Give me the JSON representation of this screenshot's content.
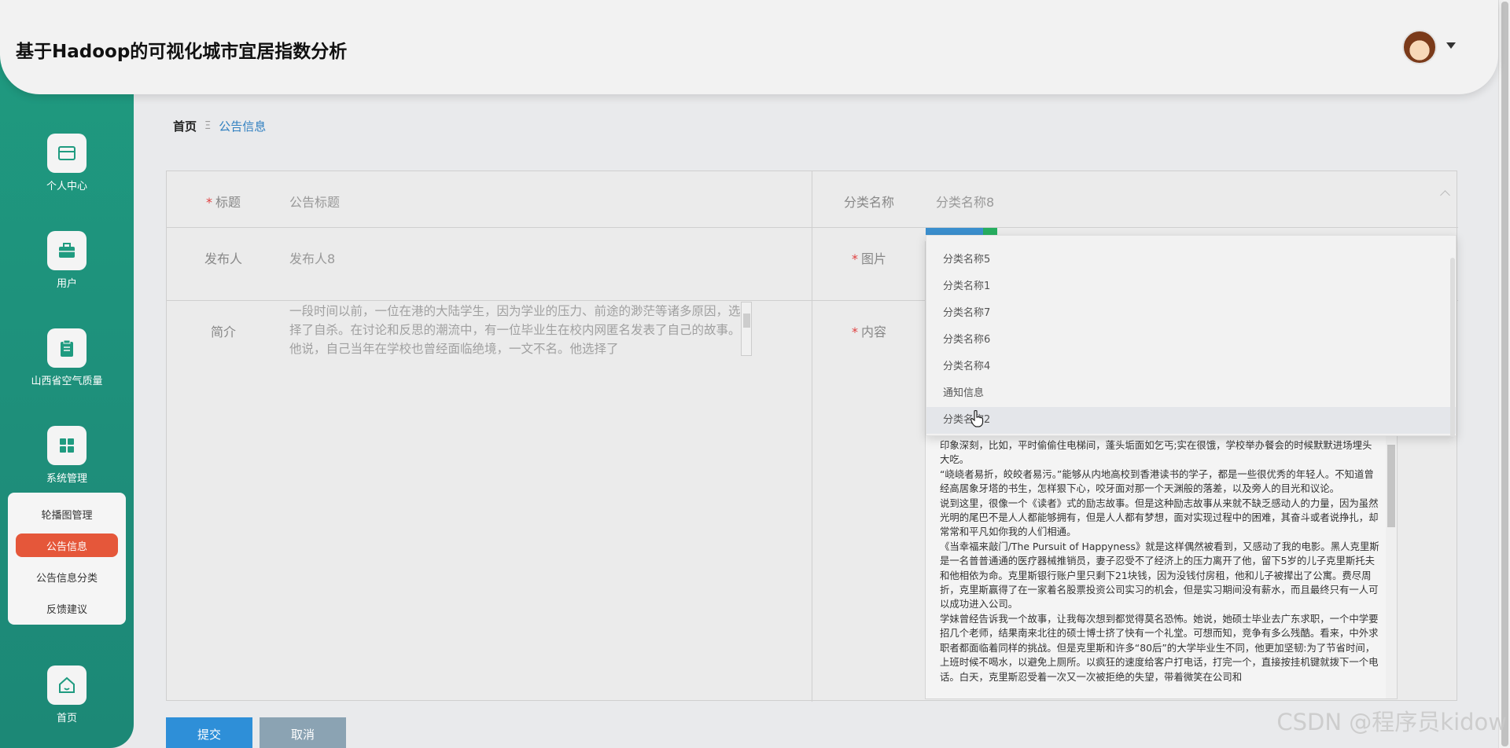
{
  "header": {
    "title": "基于Hadoop的可视化城市宜居指数分析"
  },
  "sidebar": {
    "items": [
      {
        "label": "个人中心",
        "icon": "card-icon"
      },
      {
        "label": "用户",
        "icon": "briefcase-icon"
      },
      {
        "label": "山西省空气质量",
        "icon": "clipboard-icon"
      },
      {
        "label": "系统管理",
        "icon": "grid-icon"
      },
      {
        "label": "首页",
        "icon": "home-icon"
      }
    ],
    "submenu": [
      {
        "label": "轮播图管理",
        "active": false
      },
      {
        "label": "公告信息",
        "active": true
      },
      {
        "label": "公告信息分类",
        "active": false
      },
      {
        "label": "反馈建议",
        "active": false
      }
    ]
  },
  "breadcrumb": {
    "home": "首页",
    "current": "公告信息"
  },
  "form": {
    "title_label": "标题",
    "title_value": "公告标题",
    "category_label": "分类名称",
    "category_value": "分类名称8",
    "publisher_label": "发布人",
    "publisher_value": "发布人8",
    "image_label": "图片",
    "summary_label": "简介",
    "summary_value": "一段时间以前，一位在港的大陆学生，因为学业的压力、前途的渺茫等诸多原因，选择了自杀。在讨论和反思的潮流中，有一位毕业生在校内网匿名发表了自己的故事。他说，自己当年在学校也曾经面临绝境，一文不名。他选择了",
    "content_label": "内容",
    "content_paragraphs": [
      "印象深刻，比如，平时偷偷住电梯间，蓬头垢面如乞丐;实在很饿，学校举办餐会的时候默默进场埋头大吃。",
      "“峣峣者易折，皎皎者易污。”能够从内地高校到香港读书的学子，都是一些很优秀的年轻人。不知道曾经高居象牙塔的书生，怎样狠下心，咬牙面对那一个天渊般的落差，以及旁人的目光和议论。",
      "说到这里，很像一个《读者》式的励志故事。但是这种励志故事从来就不缺乏感动人的力量，因为虽然光明的尾巴不是人人都能够拥有，但是人人都有梦想，面对实现过程中的困难，其奋斗或者说挣扎，却常常和平凡如你我的人们相通。",
      "《当幸福来敲门/The Pursuit of Happyness》就是这样偶然被看到，又感动了我的电影。黑人克里斯是一名普普通通的医疗器械推销员，妻子忍受不了经济上的压力离开了他，留下5岁的儿子克里斯托夫和他相依为命。克里斯银行账户里只剩下21块钱，因为没钱付房租，他和儿子被撵出了公寓。费尽周折，克里斯赢得了在一家着名股票投资公司实习的机会，但是实习期间没有薪水，而且最终只有一人可以成功进入公司。",
      "学妹曾经告诉我一个故事，让我每次想到都觉得莫名恐怖。她说，她硕士毕业去广东求职，一个中学要招几个老师，结果南来北往的硕士博士挤了快有一个礼堂。可想而知，竞争有多么残酷。看来，中外求职者都面临着同样的挑战。但是克里斯和许多“80后”的大学毕业生不同，他更加坚韧:为了节省时间，上班时候不喝水，以避免上厕所。以疯狂的速度给客户打电话，打完一个，直接按挂机键就拨下一个电话。白天，克里斯忍受着一次又一次被拒绝的失望，带着微笑在公司和"
    ]
  },
  "dropdown": {
    "options": [
      "分类名称5",
      "分类名称1",
      "分类名称7",
      "分类名称6",
      "分类名称4",
      "通知信息",
      "分类名称2"
    ],
    "hovered_index": 6
  },
  "buttons": {
    "submit": "提交",
    "cancel": "取消"
  },
  "watermark": "CSDN @程序员kidow",
  "colors": {
    "sidebar": "#1f9b80",
    "active_menu": "#e5573a",
    "submit": "#2e8fd8",
    "cancel": "#8ba3b3",
    "link": "#2f7fc0"
  }
}
